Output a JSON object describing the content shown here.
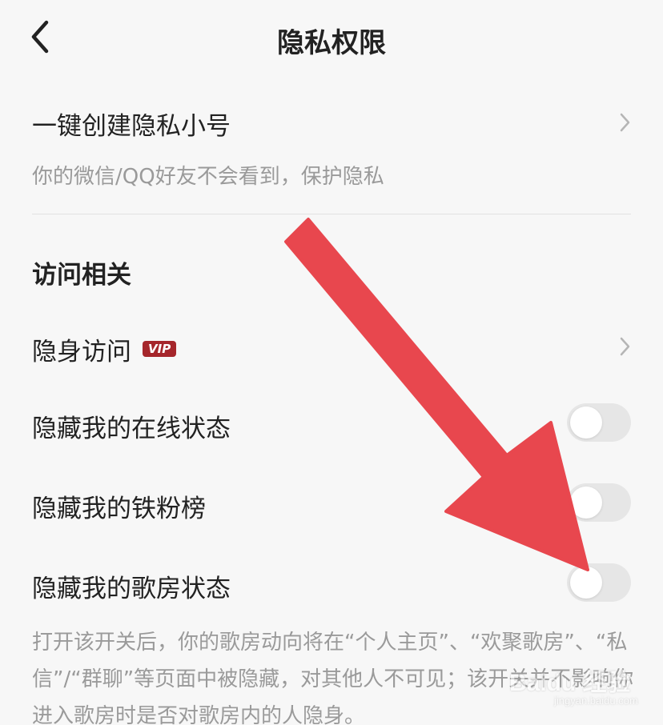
{
  "header": {
    "title": "隐私权限",
    "back_icon": "chevron-left-icon"
  },
  "private_account": {
    "title": "一键创建隐私小号",
    "subtitle": "你的微信/QQ好友不会看到，保护隐私",
    "icon": "chevron-right-icon"
  },
  "section": {
    "title": "访问相关"
  },
  "items": [
    {
      "label": "隐身访问",
      "badge": "VIP",
      "type": "link",
      "icon": "chevron-right-icon"
    },
    {
      "label": "隐藏我的在线状态",
      "type": "toggle",
      "on": false
    },
    {
      "label": "隐藏我的铁粉榜",
      "type": "toggle",
      "on": false
    },
    {
      "label": "隐藏我的歌房状态",
      "type": "toggle",
      "on": false
    }
  ],
  "description": "打开该开关后，你的歌房动向将在“个人主页”、“欢聚歌房”、“私信”/“群聊”等页面中被隐藏，对其他人不可见；该开关并不影响你进入歌房时是否对歌房内的人隐身。",
  "watermark": {
    "main": "Baidu 经验",
    "sub": "jingyan.baidu.com"
  },
  "colors": {
    "background": "#f7f7f7",
    "vip_badge": "#a5262b",
    "toggle_off": "#e6e6e6",
    "annotation_arrow": "#e8474e",
    "secondary_text": "#9a9a9a"
  }
}
